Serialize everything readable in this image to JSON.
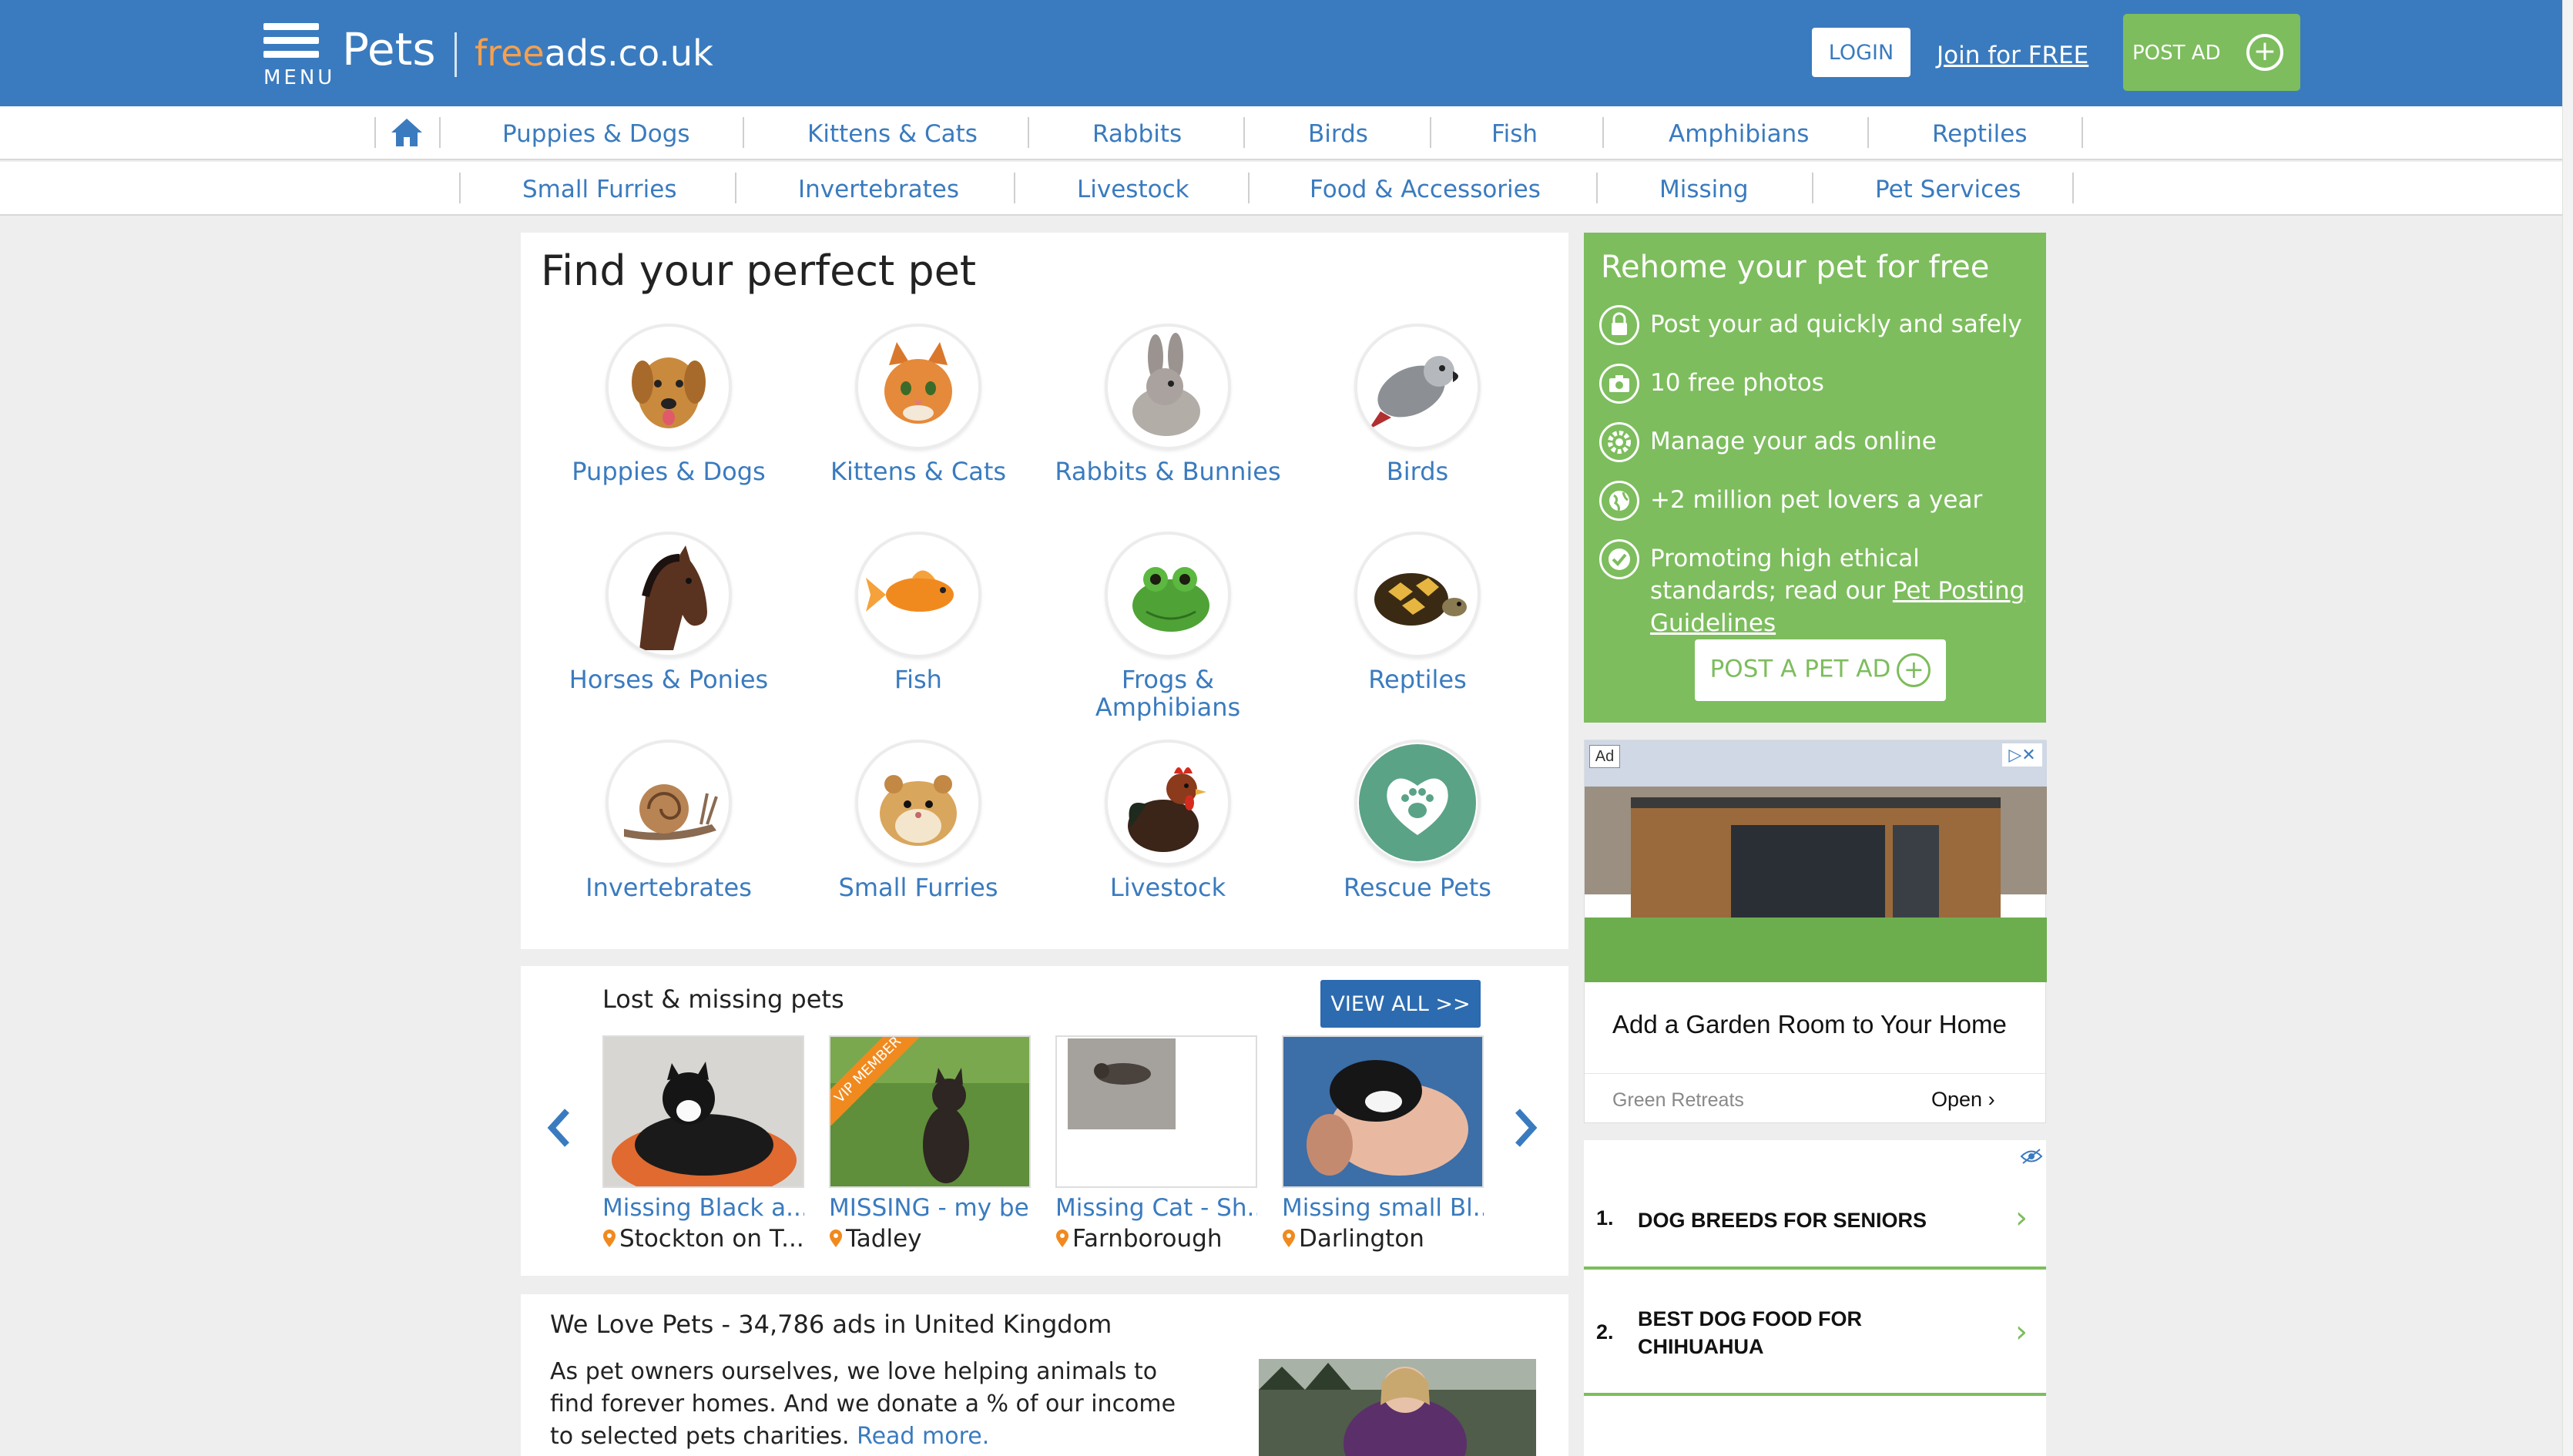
{
  "header": {
    "menu_label": "MENU",
    "brand": "Pets",
    "site_free": "free",
    "site_rest": "ads.co.uk",
    "login": "LOGIN",
    "join": "Join for FREE",
    "post_ad": "POST AD"
  },
  "nav": {
    "row1": [
      "Puppies & Dogs",
      "Kittens & Cats",
      "Rabbits",
      "Birds",
      "Fish",
      "Amphibians",
      "Reptiles"
    ],
    "row2": [
      "Small Furries",
      "Invertebrates",
      "Livestock",
      "Food & Accessories",
      "Missing",
      "Pet Services"
    ]
  },
  "find": {
    "title": "Find your perfect pet",
    "categories": [
      {
        "label": "Puppies & Dogs",
        "icon": "dog-icon"
      },
      {
        "label": "Kittens & Cats",
        "icon": "cat-icon"
      },
      {
        "label": "Rabbits & Bunnies",
        "icon": "rabbit-icon"
      },
      {
        "label": "Birds",
        "icon": "parrot-icon"
      },
      {
        "label": "Horses & Ponies",
        "icon": "horse-icon"
      },
      {
        "label": "Fish",
        "icon": "goldfish-icon"
      },
      {
        "label": "Frogs & Amphibians",
        "icon": "frog-icon"
      },
      {
        "label": "Reptiles",
        "icon": "tortoise-icon"
      },
      {
        "label": "Invertebrates",
        "icon": "snail-icon"
      },
      {
        "label": "Small Furries",
        "icon": "hamster-icon"
      },
      {
        "label": "Livestock",
        "icon": "chicken-icon"
      },
      {
        "label": "Rescue Pets",
        "icon": "heart-paw-icon"
      }
    ]
  },
  "lost": {
    "title": "Lost & missing pets",
    "view_all": "VIEW ALL >>",
    "vip_badge": "VIP MEMBER",
    "pets": [
      {
        "title": "Missing Black a...",
        "location": "Stockton on T..."
      },
      {
        "title": "MISSING - my be...",
        "location": "Tadley"
      },
      {
        "title": "Missing Cat - Sh...",
        "location": "Farnborough"
      },
      {
        "title": "Missing small Bl...",
        "location": "Darlington"
      }
    ]
  },
  "love": {
    "title": "We Love Pets - 34,786 ads in United Kingdom",
    "text": "As pet owners ourselves, we love helping animals to find forever homes. And we donate a % of our income to selected pets charities.",
    "read_more": "Read more."
  },
  "rehome": {
    "title": "Rehome your pet for free",
    "items": [
      {
        "text": "Post your ad quickly and safely",
        "icon": "lock-icon"
      },
      {
        "text": "10 free photos",
        "icon": "camera-icon"
      },
      {
        "text": "Manage your ads online",
        "icon": "gear-icon"
      },
      {
        "text": "+2 million pet lovers a year",
        "icon": "globe-icon"
      },
      {
        "text": "Promoting high ethical standards; read our",
        "link": "Pet Posting Guidelines",
        "icon": "check-icon"
      }
    ],
    "button": "POST A PET AD"
  },
  "ad": {
    "badge": "Ad",
    "headline": "Add a Garden Room to Your Home",
    "source": "Green Retreats",
    "open": "Open"
  },
  "related": [
    {
      "num": "1.",
      "text": "DOG BREEDS FOR SENIORS"
    },
    {
      "num": "2.",
      "text": "BEST DOG FOOD FOR CHIHUAHUA"
    }
  ],
  "colors": {
    "header_blue": "#3a7bbf",
    "accent_green": "#7dbd5d",
    "link_blue": "#3a7bbf",
    "free_orange": "#f6a04d"
  }
}
